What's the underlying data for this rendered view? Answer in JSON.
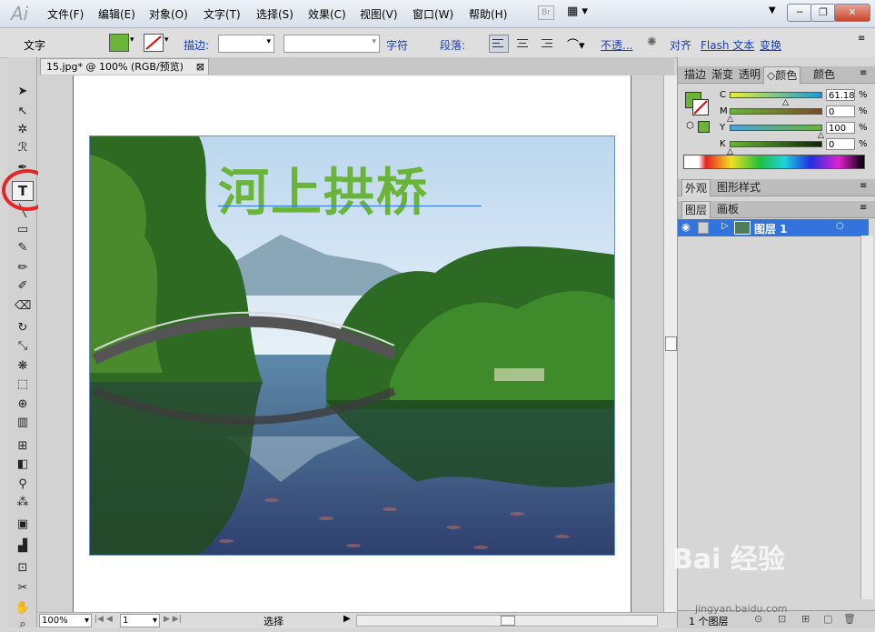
{
  "app": {
    "logo": "Ai",
    "bridge_label": "Br"
  },
  "menu": [
    "文件(F)",
    "编辑(E)",
    "对象(O)",
    "文字(T)",
    "选择(S)",
    "效果(C)",
    "视图(V)",
    "窗口(W)",
    "帮助(H)"
  ],
  "window_controls": {
    "minimize": "─",
    "restore": "❐",
    "close": "✕"
  },
  "control_bar": {
    "label": "文字",
    "stroke_label": "描边:",
    "char_label": "字符",
    "para_label": "段落:",
    "opacity_label": "不透...",
    "align_label": "对齐",
    "flash_label": "Flash 文本",
    "transform_label": "变换",
    "fill_color": "#6bb43a"
  },
  "document": {
    "tab_title": "15.jpg* @ 100% (RGB/预览)",
    "tab_close": "⊠"
  },
  "artwork": {
    "heading": "河上拱桥"
  },
  "status": {
    "zoom": "100%",
    "page": "1",
    "mode": "选择"
  },
  "panels": {
    "top_tabs": [
      "描边",
      "渐变",
      "透明",
      "◇颜色",
      "颜色"
    ],
    "color": {
      "C": {
        "label": "C",
        "value": "61.18",
        "percent": 61.18
      },
      "M": {
        "label": "M",
        "value": "0",
        "percent": 0
      },
      "Y": {
        "label": "Y",
        "value": "100",
        "percent": 100
      },
      "K": {
        "label": "K",
        "value": "0",
        "percent": 0
      },
      "pct_sign": "%"
    },
    "appearance_tabs": [
      "外观",
      "图形样式"
    ],
    "layers_tabs": [
      "图层",
      "画板"
    ],
    "layer": {
      "name": "图层 1"
    },
    "layer_count": "1 个图层"
  },
  "watermark": {
    "text": "Bai 经验",
    "url": "jingyan.baidu.com"
  },
  "colors": {
    "accent_blue": "#3273dc",
    "heading_green": "#6bb43a",
    "annotation_red": "#e52626"
  }
}
